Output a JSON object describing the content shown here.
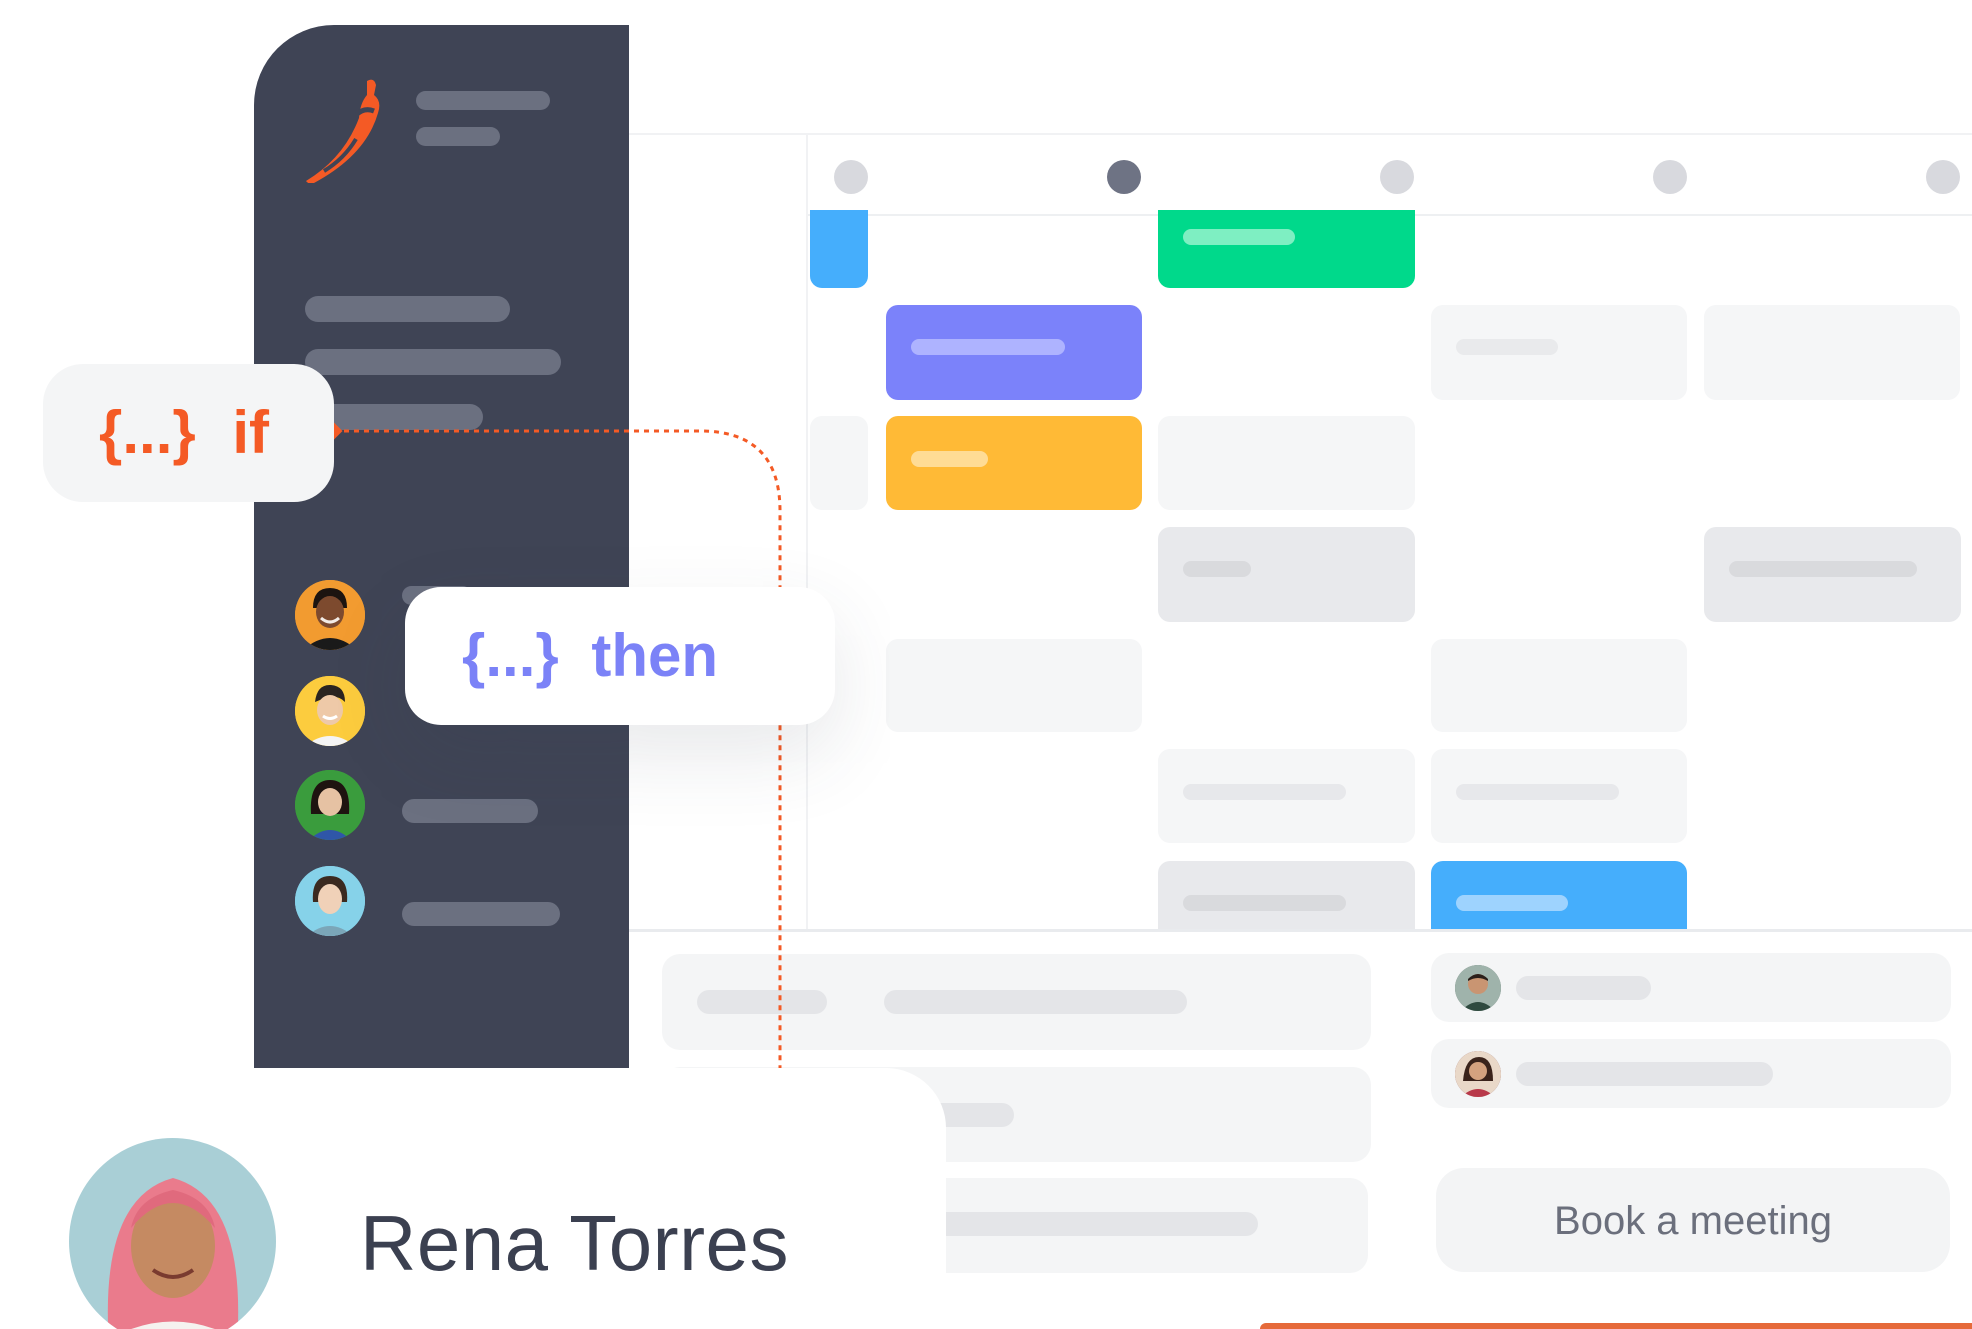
{
  "person": {
    "name": "Rena Torres"
  },
  "rules": {
    "if_label": "if",
    "then_label": "then",
    "braces": "{...}"
  },
  "actions": {
    "book_label": "Book a meeting"
  },
  "colors": {
    "sidebar_bg": "#3f4455",
    "accent_orange": "#f45a25",
    "accent_purple": "#7b82f7",
    "event_blue": "#45aefc",
    "event_green": "#00d98b",
    "event_purple": "#7b82fa",
    "event_yellow": "#ffba36"
  },
  "icons": {
    "logo": "chili-pepper-icon"
  }
}
